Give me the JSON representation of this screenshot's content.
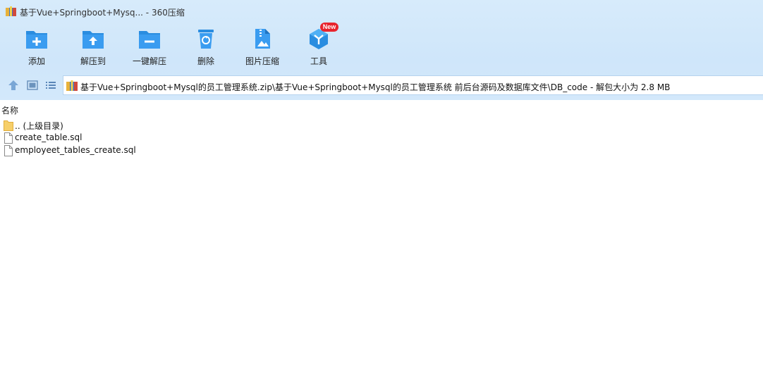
{
  "window": {
    "title": "基于Vue+Springboot+Mysq... - 360压缩"
  },
  "toolbar": {
    "items": [
      {
        "label": "添加",
        "icon": "add-folder-icon"
      },
      {
        "label": "解压到",
        "icon": "extract-to-icon"
      },
      {
        "label": "一键解压",
        "icon": "one-click-extract-icon"
      },
      {
        "label": "删除",
        "icon": "delete-trash-icon"
      },
      {
        "label": "图片压缩",
        "icon": "image-compress-icon"
      },
      {
        "label": "工具",
        "icon": "tools-icon"
      }
    ],
    "new_badge": "New"
  },
  "address_bar": {
    "path": "基于Vue+Springboot+Mysql的员工管理系统.zip\\基于Vue+Springboot+Mysql的员工管理系统 前后台源码及数据库文件\\DB_code - 解包大小为 2.8 MB"
  },
  "file_list": {
    "column_name": "名称",
    "rows": [
      {
        "name": ".. (上级目录)",
        "icon": "folder-icon"
      },
      {
        "name": "create_table.sql",
        "icon": "file-icon"
      },
      {
        "name": "employeet_tables_create.sql",
        "icon": "file-icon"
      }
    ]
  },
  "colors": {
    "chrome_bg": "#d3e8fb",
    "icon_blue": "#2a8de0",
    "badge_red": "#e8242d"
  }
}
